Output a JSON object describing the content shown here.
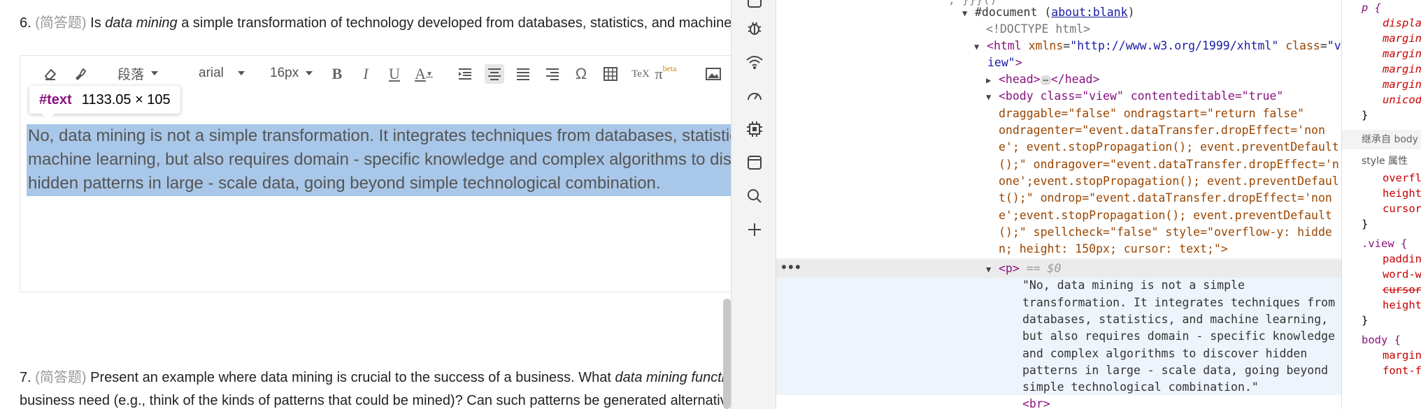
{
  "question6": {
    "number": "6.",
    "type": "(简答题)",
    "text_before": "Is ",
    "text_italic": "data mining",
    "text_after": " a simple transformation of technology developed from databases, statistics, and machine learning?"
  },
  "toolbar": {
    "paragraph": "段落",
    "font": "arial",
    "size": "16px",
    "bold": "B",
    "italic": "I",
    "underline": "U",
    "fontcolor": "A",
    "omega": "Ω",
    "tex": "TeX",
    "pi": "π",
    "beta": "beta"
  },
  "tooltip": {
    "keyword": "#text",
    "size": "1133.05 × 105"
  },
  "answer": {
    "line1": "No, data mining is not a simple transformation. It integrates techniques from databases, statistics, and",
    "line2": "machine learning, but also requires domain - specific knowledge and complex algorithms to discover",
    "line3": "hidden patterns in large - scale data, going beyond simple technological combination."
  },
  "question7": {
    "number": "7.",
    "type": "(简答题)",
    "text_before": "Present an example where data mining is crucial to the success of a business. What ",
    "text_italic": "data mining functionalities",
    "line2": "business need (e.g., think of the kinds of patterns that could be mined)? Can such patterns be generated alternatively"
  },
  "devtools": {
    "top_partial": "\",\"}}}()\"",
    "document": "#document",
    "about_blank": "about:blank",
    "doctype": "<!DOCTYPE html>",
    "html_tag": "html",
    "html_xmlns_attr": "xmlns",
    "html_xmlns_val": "\"http://www.w3.org/1999/xhtml\"",
    "html_class_attr": "class",
    "html_class_val_a": "\"v",
    "html_class_val_b": "iew\"",
    "head_open": "<head>",
    "head_close": "</head>",
    "body_lines": [
      "<body class=\"view\" contenteditable=\"true\"",
      "draggable=\"false\" ondragstart=\"return false\"",
      "ondragenter=\"event.dataTransfer.dropEffect='non",
      "e'; event.stopPropagation(); event.preventDefault",
      "();\" ondragover=\"event.dataTransfer.dropEffect='n",
      "one';event.stopPropagation(); event.preventDefaul",
      "t();\" ondrop=\"event.dataTransfer.dropEffect='non",
      "e';event.stopPropagation(); event.preventDefault",
      "();\" spellcheck=\"false\" style=\"overflow-y: hidde",
      "n; height: 150px; cursor: text;\">"
    ],
    "p_tag": "<p>",
    "p_eq": "== $0",
    "text_node_lines": [
      "\"No, data mining is not a simple",
      "transformation. It integrates techniques from",
      "databases, statistics, and machine learning,",
      "but also requires domain - specific knowledge",
      "and complex algorithms to discover hidden",
      "patterns in large - scale data, going beyond",
      "simple technological combination.\""
    ],
    "br": "<br>",
    "dots": "•••"
  },
  "styles": {
    "p_sel": "p {",
    "p_props": [
      "display",
      "margin",
      "margin",
      "margin",
      "margin",
      "unicode"
    ],
    "close1": "}",
    "inherit": "继承自 body",
    "style_label": "style 属性",
    "style_props": [
      "overfl",
      "height",
      "cursor"
    ],
    "close2": "}",
    "view_sel": ".view {",
    "view_props": [
      "paddin",
      "word-w",
      "cursor",
      "height"
    ],
    "close3": "}",
    "body_sel": "body {",
    "body_props": [
      "margin",
      "font-f"
    ]
  },
  "colors": {
    "selection": "#a9c7e8",
    "tag": "#881280",
    "attr_name": "#994500",
    "attr_value": "#1a1aa6"
  }
}
